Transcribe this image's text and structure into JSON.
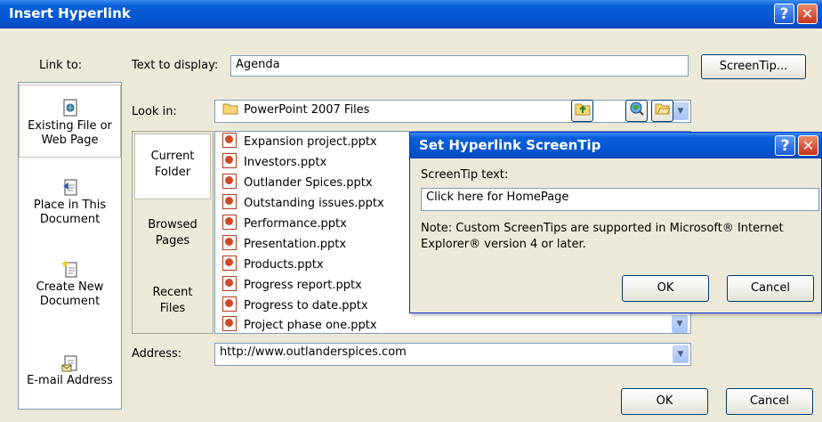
{
  "window": {
    "title": "Insert Hyperlink",
    "help_glyph": "?",
    "close_glyph": "✕"
  },
  "text_to_display": {
    "label": "Text to display:",
    "value": "Agenda"
  },
  "screentip_button": "ScreenTip...",
  "link_to": {
    "label": "Link to:",
    "items": [
      {
        "line1": "Existing File or",
        "line2": "Web Page",
        "icon": "existing-file-icon"
      },
      {
        "line1": "Place in This",
        "line2": "Document",
        "icon": "place-in-document-icon"
      },
      {
        "line1": "Create New",
        "line2": "Document",
        "icon": "new-document-icon"
      },
      {
        "line1": "E-mail Address",
        "line2": "",
        "icon": "email-icon"
      }
    ]
  },
  "look_in": {
    "label": "Look in:",
    "value": "PowerPoint 2007 Files"
  },
  "nav": {
    "items": [
      {
        "line1": "Current",
        "line2": "Folder"
      },
      {
        "line1": "Browsed",
        "line2": "Pages"
      },
      {
        "line1": "Recent",
        "line2": "Files"
      }
    ]
  },
  "files": [
    "Expansion project.pptx",
    "Investors.pptx",
    "Outlander Spices.pptx",
    "Outstanding issues.pptx",
    "Performance.pptx",
    "Presentation.pptx",
    "Products.pptx",
    "Progress report.pptx",
    "Progress to date.pptx",
    "Project phase one.pptx"
  ],
  "address": {
    "label": "Address:",
    "value": "http://www.outlanderspices.com"
  },
  "buttons": {
    "ok": "OK",
    "cancel": "Cancel"
  },
  "screentip_dialog": {
    "title": "Set Hyperlink ScreenTip",
    "field_label": "ScreenTip text:",
    "field_value": "Click here for HomePage",
    "note_line1": "Note: Custom ScreenTips are supported in Microsoft® Internet",
    "note_line2": "Explorer® version 4 or later.",
    "ok": "OK",
    "cancel": "Cancel"
  },
  "colors": {
    "titlebar": "#0555d0",
    "dialog_bg": "#ece9d8",
    "close_button": "#c8341a"
  }
}
